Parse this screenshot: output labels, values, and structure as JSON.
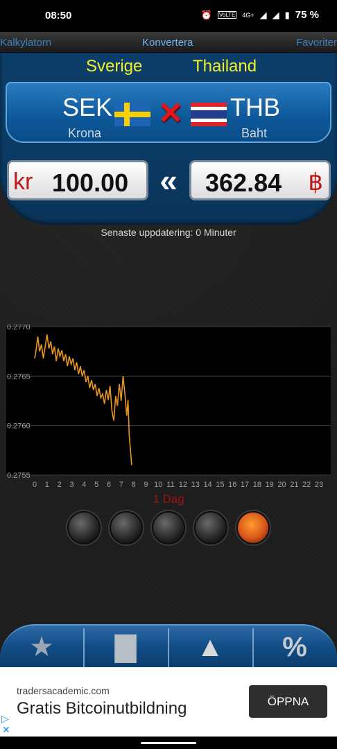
{
  "status_bar": {
    "time": "08:50",
    "icons": [
      "alarm-icon",
      "volte-icon",
      "4g-icon",
      "signal-icon",
      "signal-icon",
      "battery-icon"
    ],
    "volte": "VoLTE",
    "network": "4G+",
    "battery": "75 %"
  },
  "nav": {
    "left": "Kalkylatorn",
    "middle": "Konvertera",
    "right": "Favoriter"
  },
  "converter": {
    "from_country": "Sverige",
    "to_country": "Thailand",
    "from_code": "SEK",
    "to_code": "THB",
    "from_name": "Krona",
    "to_name": "Baht",
    "from_symbol": "kr",
    "to_symbol": "฿",
    "from_amount": "100.00",
    "to_amount": "362.84",
    "swap_icon": "swap-x-icon",
    "direction_icon": "double-chevron-left-icon",
    "update_text": "Senaste uppdatering: 0 Minuter"
  },
  "chart_data": {
    "type": "line",
    "title": "",
    "xlabel": "",
    "ylabel": "",
    "x_ticks": [
      "0",
      "1",
      "2",
      "3",
      "4",
      "5",
      "6",
      "7",
      "8",
      "9",
      "10",
      "11",
      "12",
      "13",
      "14",
      "15",
      "16",
      "17",
      "18",
      "19",
      "20",
      "21",
      "22",
      "23"
    ],
    "y_ticks": [
      "0.2770",
      "0.2765",
      "0.2760",
      "0.2755"
    ],
    "xlim": [
      0,
      23
    ],
    "ylim": [
      0.2755,
      0.277
    ],
    "grid": true,
    "line_color": "#e8961e",
    "series": [
      {
        "x": [
          0.0,
          0.1,
          0.25,
          0.4,
          0.55,
          0.7,
          0.85,
          1.0,
          1.15,
          1.3,
          1.45,
          1.6,
          1.75,
          1.9,
          2.05,
          2.2,
          2.35,
          2.5,
          2.65,
          2.8,
          2.95,
          3.1,
          3.25,
          3.4,
          3.55,
          3.7,
          3.85,
          4.0,
          4.15,
          4.3,
          4.45,
          4.6,
          4.75,
          4.9,
          5.05,
          5.2,
          5.35,
          5.5,
          5.65,
          5.8,
          5.95,
          6.1,
          6.25,
          6.4,
          6.55,
          6.7,
          6.85,
          7.0,
          7.15,
          7.3,
          7.45,
          7.55,
          7.65,
          7.75,
          7.85
        ],
        "y": [
          0.27668,
          0.27675,
          0.2769,
          0.27675,
          0.27682,
          0.27668,
          0.2768,
          0.27692,
          0.27678,
          0.27685,
          0.27672,
          0.2768,
          0.27665,
          0.27678,
          0.2767,
          0.27676,
          0.27665,
          0.27672,
          0.2766,
          0.2767,
          0.27662,
          0.27668,
          0.27656,
          0.27664,
          0.27652,
          0.2766,
          0.2765,
          0.27656,
          0.27644,
          0.2765,
          0.27638,
          0.27646,
          0.27636,
          0.27642,
          0.2763,
          0.27638,
          0.27628,
          0.27632,
          0.27622,
          0.27636,
          0.27626,
          0.2764,
          0.27615,
          0.27605,
          0.2763,
          0.2762,
          0.27642,
          0.27625,
          0.2765,
          0.27632,
          0.2761,
          0.27626,
          0.2759,
          0.27575,
          0.2756
        ]
      }
    ],
    "period_label": "1 Dag"
  },
  "period_selector": {
    "count": 5,
    "active_index": 4
  },
  "toolbar": {
    "items": [
      {
        "name": "favorites-add-icon",
        "glyph": "★"
      },
      {
        "name": "bar-chart-icon",
        "glyph": "▇"
      },
      {
        "name": "pyramid-icon",
        "glyph": "▲"
      },
      {
        "name": "percent-icon",
        "glyph": "%"
      }
    ]
  },
  "ad": {
    "domain": "tradersacademic.com",
    "title": "Gratis Bitcoinutbildning",
    "button": "ÖPPNA"
  }
}
